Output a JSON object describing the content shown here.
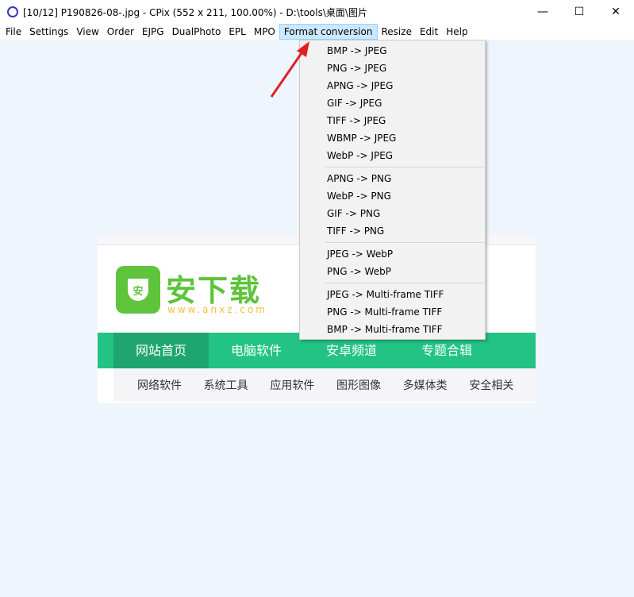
{
  "window": {
    "title": "[10/12] P190826-08-.jpg - CPix (552 x 211, 100.00%) - D:\\tools\\桌面\\图片",
    "minimize": "—",
    "maximize": "☐",
    "close": "✕"
  },
  "menubar": [
    "File",
    "Settings",
    "View",
    "Order",
    "EJPG",
    "DualPhoto",
    "EPL",
    "MPO",
    "Format conversion",
    "Resize",
    "Edit",
    "Help"
  ],
  "dropdown": {
    "groups": [
      [
        "BMP -> JPEG",
        "PNG -> JPEG",
        "APNG -> JPEG",
        "GIF -> JPEG",
        "TIFF -> JPEG",
        "WBMP -> JPEG",
        "WebP -> JPEG"
      ],
      [
        "APNG -> PNG",
        "WebP -> PNG",
        "GIF -> PNG",
        "TIFF -> PNG"
      ],
      [
        "JPEG -> WebP",
        "PNG -> WebP"
      ],
      [
        "JPEG -> Multi-frame TIFF",
        "PNG -> Multi-frame TIFF",
        "BMP -> Multi-frame TIFF"
      ]
    ]
  },
  "picture": {
    "logo_badge": "安",
    "logo_text": "安下载",
    "logo_url": "www.anxz.com",
    "nav": [
      "网站首页",
      "电脑软件",
      "安卓频道",
      "专题合辑"
    ],
    "subnav": [
      "网络软件",
      "系统工具",
      "应用软件",
      "图形图像",
      "多媒体类",
      "安全相关"
    ]
  },
  "colors": {
    "accent_green": "#22c384",
    "menu_highlight": "#cce8ff",
    "arrow": "#e02020"
  }
}
